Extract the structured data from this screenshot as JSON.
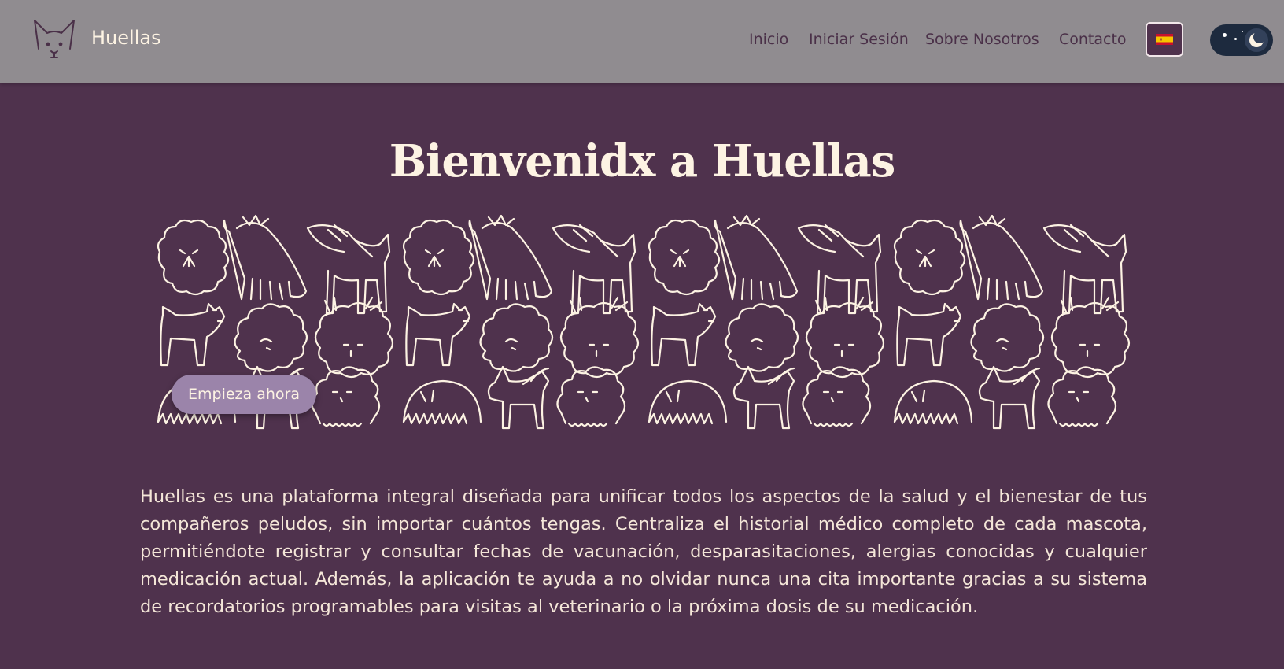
{
  "header": {
    "brand": "Huellas",
    "logo_icon": "cat-face-icon",
    "nav": [
      {
        "label": "Inicio"
      },
      {
        "label": "Iniciar Sesión"
      },
      {
        "label": "Sobre Nosotros"
      },
      {
        "label": "Contacto"
      }
    ],
    "language_icon": "spain-flag-icon",
    "theme_icon": "moon-icon"
  },
  "hero": {
    "title": "Bienvenidx a Huellas",
    "pattern_icon": "pet-doodle-pattern",
    "cta_label": "Empieza ahora"
  },
  "description": "Huellas es una plataforma integral diseñada para unificar todos los aspectos de la salud y el bienestar de tus compañeros peludos, sin importar cuántos tengas. Centraliza el historial médico completo de cada mascota, permitiéndote registrar y consultar fechas de vacunación, desparasitaciones, alergias conocidas y cualquier medicación actual. Además, la aplicación te ayuda a no olvidar nunca una cita importante gracias a su sistema de recordatorios programables para visitas al veterinario o la próxima dosis de su medicación.",
  "colors": {
    "background": "#4f324d",
    "navbar": "#908c90",
    "text_light": "#fdf3e3",
    "nav_text": "#4a3048",
    "button": "#9b84aa",
    "toggle": "#1d2a3e"
  }
}
